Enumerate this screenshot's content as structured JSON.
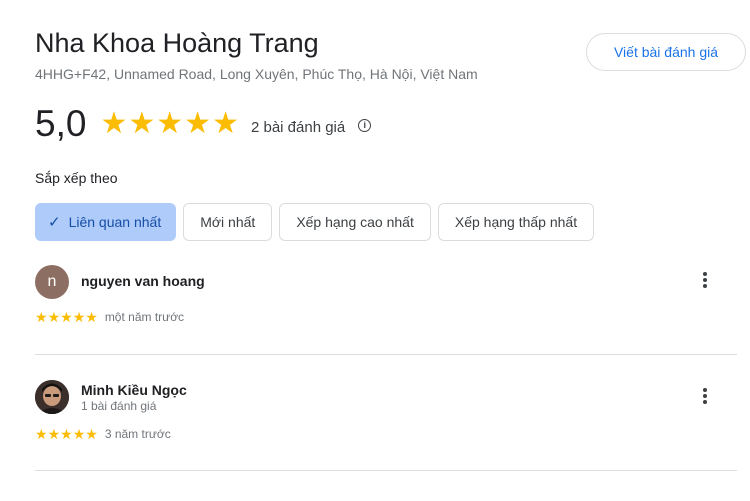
{
  "place": {
    "title": "Nha Khoa Hoàng Trang",
    "address": "4HHG+F42, Unnamed Road, Long Xuyên, Phúc Thọ, Hà Nội, Việt Nam",
    "write_review_label": "Viết bài đánh giá"
  },
  "rating": {
    "score": "5,0",
    "stars": 5,
    "review_count": "2 bài đánh giá",
    "info_icon": "info-icon"
  },
  "sort": {
    "label": "Sắp xếp theo",
    "chips": [
      {
        "label": "Liên quan nhất",
        "selected": true
      },
      {
        "label": "Mới nhất",
        "selected": false
      },
      {
        "label": "Xếp hạng cao nhất",
        "selected": false
      },
      {
        "label": "Xếp hạng thấp nhất",
        "selected": false
      }
    ]
  },
  "reviews": [
    {
      "initial": "n",
      "name": "nguyen van hoang",
      "meta": "",
      "stars": 5,
      "time": "một năm trước"
    },
    {
      "initial": "",
      "name": "Minh Kiều Ngọc",
      "meta": "1 bài đánh giá",
      "stars": 5,
      "time": "3 năm trước"
    }
  ],
  "colors": {
    "star": "#fbbc04",
    "accent": "#1a73e8",
    "chip_selected": "#aecbfa"
  }
}
